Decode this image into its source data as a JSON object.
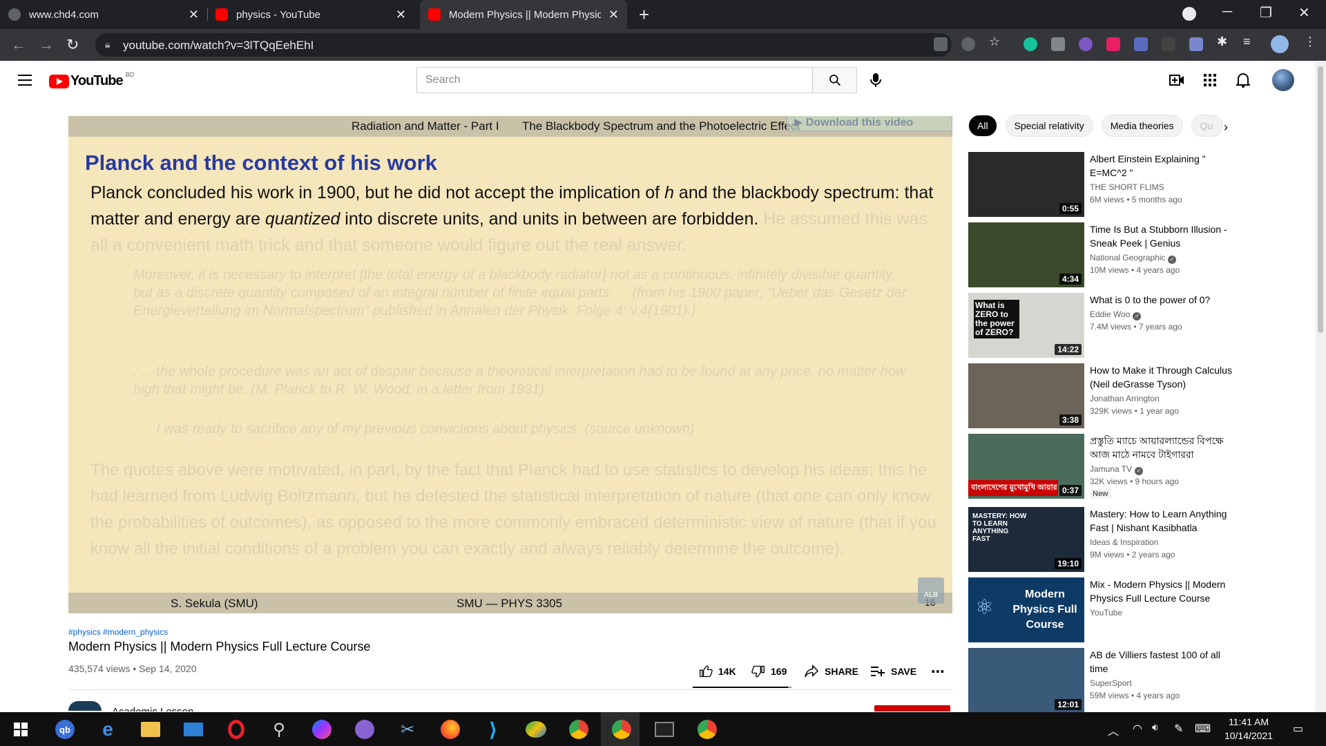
{
  "browser": {
    "tabs": [
      {
        "title": "www.chd4.com"
      },
      {
        "title": "physics - YouTube"
      },
      {
        "title": "Modern Physics || Modern Physic"
      }
    ],
    "url": "youtube.com/watch?v=3lTQqEehEhI"
  },
  "header": {
    "logo": "YouTube",
    "country": "BD",
    "search_placeholder": "Search"
  },
  "player": {
    "top_left": "Radiation and Matter - Part I",
    "top_right": "The Blackbody Spectrum and the Photoelectric Effect",
    "download": "Download this video",
    "title": "Planck and the context of his work",
    "p1_a": "Planck concluded his work in 1900, but he did not accept the implication of ",
    "p1_h": "h",
    "p1_b": " and the blackbody spectrum: that matter and energy are ",
    "p1_q": "quantized",
    "p1_c": " into discrete units, and units in between are forbidden.",
    "p1_faded": " He assumed this was all a convenient math trick and that someone would figure out the real answer.",
    "quote1": "Moreover, it is necessary to interpret [the total energy of a blackbody radiator] not as a continuous, infinitely divisible quantity, but as a discrete quantity composed of an integral number of finite equal parts. . . (from his 1900 paper, “Ueber das Gesetz der Energieverteilung im Normalspectrum” published in Annalen der Physik. Folge 4: v.4(1901).)",
    "quote2": ". . . the whole procedure was an act of despair because a theoretical interpretation had to be found at any price, no matter how high that might be. (M. Planck to R. W. Wood, in a letter from 1931)",
    "quote3": ". . . I was ready to sacrifice any of my previous convictions about physics. (source unknown)",
    "p2": "The quotes above were motivated, in part, by the fact that Planck had to use statistics to develop his ideas; this he had learned from Ludwig Boltzmann, but he detested the statistical interpretation of nature (that one can only know the probabilities of outcomes), as opposed to the more commonly embraced deterministic view of nature (that if you know all the initial conditions of a problem you can exactly and always reliably determine the outcome).",
    "foot_left": "S. Sekula  (SMU)",
    "foot_center": "SMU — PHYS 3305",
    "page_num": "16",
    "watermark": "ALB"
  },
  "video": {
    "hashtags": "#physics #modern_physics",
    "title": "Modern Physics || Modern Physics Full Lecture Course",
    "meta": "435,574 views • Sep 14, 2020",
    "likes": "14K",
    "dislikes": "169",
    "like_ratio": 0.965,
    "share": "SHARE",
    "save": "SAVE",
    "channel": "Academic Lesson"
  },
  "chips": [
    {
      "label": "All"
    },
    {
      "label": "Special relativity"
    },
    {
      "label": "Media theories"
    },
    {
      "label": "Qu"
    }
  ],
  "recommendations": [
    {
      "title": "Albert Einstein Explaining \" E=MC^2 \"",
      "channel": "THE SHORT FLIMS",
      "meta": "6M views • 5 months ago",
      "duration": "0:55",
      "verified": false,
      "new": false,
      "thumb_color": "#2a2a2a"
    },
    {
      "title": "Time Is But a Stubborn Illusion - Sneak Peek | Genius",
      "channel": "National Geographic",
      "meta": "10M views • 4 years ago",
      "duration": "4:34",
      "verified": true,
      "new": false,
      "thumb_color": "#3b4a2a"
    },
    {
      "title": "What is 0 to the power of 0?",
      "channel": "Eddie Woo",
      "meta": "7.4M views • 7 years ago",
      "duration": "14:22",
      "verified": true,
      "new": false,
      "thumb_color": "#d6d6d0",
      "thumb_text": "What is ZERO to the power of ZERO?"
    },
    {
      "title": "How to Make it Through Calculus (Neil deGrasse Tyson)",
      "channel": "Jonathan Arrington",
      "meta": "329K views • 1 year ago",
      "duration": "3:38",
      "verified": false,
      "new": false,
      "thumb_color": "#6b6458"
    },
    {
      "title": "প্রস্তুতি ম্যাচে আয়ারল্যান্ডের বিপক্ষে আজ মাঠে নামবে টাইগাররা",
      "channel": "Jamuna TV",
      "meta": "32K views • 9 hours ago",
      "duration": "0:37",
      "verified": true,
      "new": true,
      "new_label": "New",
      "thumb_color": "#4a6a5a",
      "thumb_text": "বাংলাদেশের মুখোমুখি আয়ার"
    },
    {
      "title": "Mastery: How to Learn Anything Fast | Nishant Kasibhatla",
      "channel": "Ideas & Inspiration",
      "meta": "9M views • 2 years ago",
      "duration": "19:10",
      "verified": false,
      "new": false,
      "thumb_color": "#1d2a3a",
      "thumb_text": "MASTERY: HOW TO LEARN ANYTHING FAST"
    },
    {
      "title": "Mix - Modern Physics || Modern Physics Full Lecture Course",
      "channel": "YouTube",
      "meta": "",
      "duration": "",
      "verified": false,
      "new": false,
      "thumb_color": "#0d3b66",
      "thumb_text": "Modern Physics Full Course"
    },
    {
      "title": "AB de Villiers fastest 100 of all time",
      "channel": "SuperSport",
      "meta": "59M views • 4 years ago",
      "duration": "12:01",
      "verified": false,
      "new": false,
      "thumb_color": "#3a5a7a"
    }
  ],
  "taskbar": {
    "time": "11:41 AM",
    "date": "10/14/2021"
  },
  "colors": {
    "yt_red": "#ff0000",
    "link_blue": "#065fd4",
    "slide_bg": "#f5e6bc",
    "slide_title": "#283aa0"
  }
}
